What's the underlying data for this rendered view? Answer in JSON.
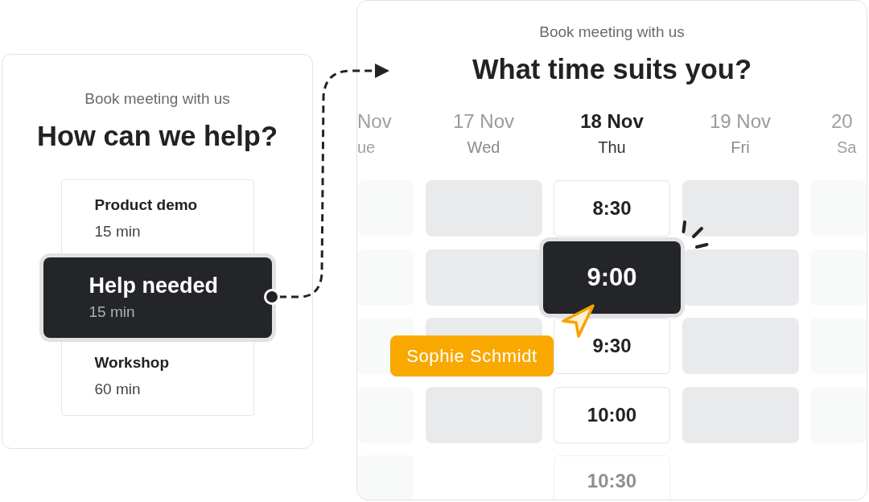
{
  "left_panel": {
    "subtitle": "Book meeting with us",
    "title": "How can we help?",
    "meeting_types": [
      {
        "name": "Product demo",
        "duration": "15 min",
        "selected": false
      },
      {
        "name": "Help needed",
        "duration": "15 min",
        "selected": true
      },
      {
        "name": "Workshop",
        "duration": "60 min",
        "selected": false
      }
    ]
  },
  "right_panel": {
    "subtitle": "Book meeting with us",
    "title": "What time suits you?",
    "days": [
      {
        "date": "Nov",
        "weekday": "ue",
        "selected": false,
        "slots": [
          {
            "kind": "unavailable",
            "selected": false
          },
          {
            "kind": "unavailable",
            "selected": false
          },
          {
            "kind": "unavailable",
            "selected": false
          },
          {
            "kind": "unavailable",
            "selected": false
          },
          {
            "kind": "unavailable",
            "selected": false
          }
        ]
      },
      {
        "date": "17 Nov",
        "weekday": "Wed",
        "selected": false,
        "slots": [
          {
            "kind": "unavailable",
            "selected": false
          },
          {
            "kind": "unavailable",
            "selected": false
          },
          {
            "kind": "unavailable",
            "selected": false
          },
          {
            "kind": "unavailable",
            "selected": false
          }
        ]
      },
      {
        "date": "18 Nov",
        "weekday": "Thu",
        "selected": true,
        "slots": [
          {
            "kind": "available",
            "time": "8:30",
            "selected": false
          },
          {
            "kind": "available",
            "time": "9:00",
            "selected": true
          },
          {
            "kind": "available",
            "time": "9:30",
            "selected": false
          },
          {
            "kind": "available",
            "time": "10:00",
            "selected": false
          },
          {
            "kind": "available",
            "time": "10:30",
            "selected": false
          }
        ]
      },
      {
        "date": "19 Nov",
        "weekday": "Fri",
        "selected": false,
        "slots": [
          {
            "kind": "unavailable",
            "selected": false
          },
          {
            "kind": "unavailable",
            "selected": false
          },
          {
            "kind": "unavailable",
            "selected": false
          },
          {
            "kind": "unavailable",
            "selected": false
          }
        ]
      },
      {
        "date": "20",
        "weekday": "Sa",
        "selected": false,
        "slots": [
          {
            "kind": "unavailable",
            "selected": false
          },
          {
            "kind": "unavailable",
            "selected": false
          },
          {
            "kind": "unavailable",
            "selected": false
          },
          {
            "kind": "unavailable",
            "selected": false
          }
        ]
      }
    ],
    "pointer": {
      "label": "Sophie Schmidt"
    }
  }
}
